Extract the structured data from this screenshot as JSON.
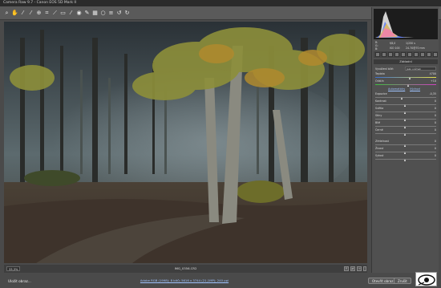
{
  "window": {
    "title": "Camera Raw 9.7  -  Canon EOS 5D Mark II"
  },
  "toolbar": {
    "tools": [
      "zoom-tool-icon",
      "hand-tool-icon",
      "white-balance-icon",
      "color-sampler-icon",
      "target-adjustment-icon",
      "crop-icon",
      "straighten-icon",
      "transform-icon",
      "spot-removal-icon",
      "red-eye-icon",
      "adjustment-brush-icon",
      "graduated-filter-icon",
      "radial-filter-icon",
      "preferences-icon",
      "rotate-ccw-icon",
      "rotate-cw-icon"
    ]
  },
  "histogram": {
    "r": "R:",
    "g": "G:",
    "b": "B:",
    "f_value": "f/8,0",
    "shutter": "1/250 s",
    "iso": "ISO 100",
    "focal": "24-70@70 mm"
  },
  "panel": {
    "title": "Základní",
    "wb_label": "Vyvážení bílé:",
    "wb_value": "Jako snímek",
    "rows": [
      {
        "label": "Teplota",
        "value": "4700"
      },
      {
        "label": "Odstín",
        "value": "+10"
      }
    ],
    "auto_link": "Automaticky",
    "default_link": "Výchozí",
    "tone_rows": [
      {
        "label": "Expozice",
        "value": "-0,35"
      },
      {
        "label": "Kontrast",
        "value": "0"
      },
      {
        "label": "Světla",
        "value": "0"
      },
      {
        "label": "Stíny",
        "value": "0"
      },
      {
        "label": "Bílé",
        "value": "0"
      },
      {
        "label": "Černé",
        "value": "0"
      }
    ],
    "presence_rows": [
      {
        "label": "Zřetelnost",
        "value": "0"
      },
      {
        "label": "Živost",
        "value": "0"
      },
      {
        "label": "Sytost",
        "value": "0"
      }
    ]
  },
  "status": {
    "zoom": "33,3%",
    "filename": "IMG_0356.CR2"
  },
  "footer": {
    "save_label": "Uložit obraz...",
    "workflow_info": "Adobe RGB (1998); 8 bitů; 5616 x 3744 (21,1MP); 240 ppi",
    "open_label": "Otevřít obraz",
    "cancel_label": "Zrušit"
  },
  "colors": {
    "accent": "#9fc3ff",
    "panel": "#505050",
    "background": "#4a4a4a"
  }
}
